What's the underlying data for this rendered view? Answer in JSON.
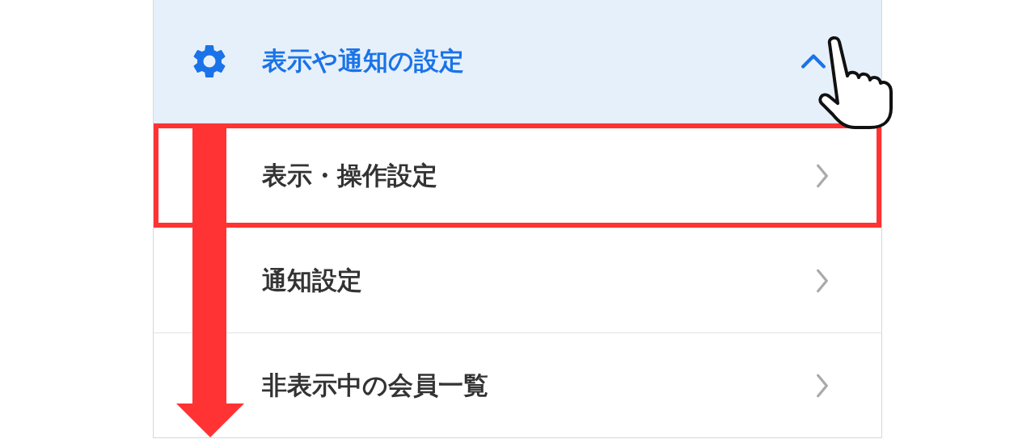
{
  "section": {
    "title": "表示や通知の設定",
    "expanded": true
  },
  "items": [
    {
      "label": "表示・操作設定",
      "highlighted": true
    },
    {
      "label": "通知設定",
      "highlighted": false
    },
    {
      "label": "非表示中の会員一覧",
      "highlighted": false
    }
  ]
}
